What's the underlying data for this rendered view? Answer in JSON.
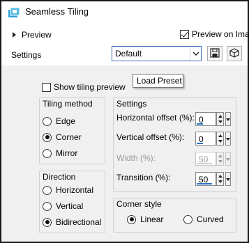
{
  "window": {
    "title": "Seamless Tiling"
  },
  "header": {
    "preview_label": "Preview",
    "preview_on_image_label": "Preview on Imag",
    "preview_on_image_checked": true,
    "settings_label": "Settings",
    "preset_value": "Default",
    "tooltip": "Load Preset"
  },
  "options": {
    "show_tiling_preview_label": "Show tiling preview",
    "show_tiling_preview_checked": false
  },
  "tiling_method": {
    "title": "Tiling method",
    "options": [
      "Edge",
      "Corner",
      "Mirror"
    ],
    "selected": "Corner"
  },
  "direction": {
    "title": "Direction",
    "options": [
      "Horizontal",
      "Vertical",
      "Bidirectional"
    ],
    "selected": "Bidirectional"
  },
  "settings_group": {
    "title": "Settings",
    "horizontal_offset": {
      "label": "Horizontal offset (%):",
      "value": "0",
      "level": 0.0
    },
    "vertical_offset": {
      "label": "Vertical offset (%):",
      "value": "0",
      "level": 0.0
    },
    "width": {
      "label": "Width (%):",
      "value": "50",
      "level": 0.5,
      "disabled": true
    },
    "transition": {
      "label": "Transition (%):",
      "value": "50",
      "level": 0.5
    }
  },
  "corner_style": {
    "title": "Corner style",
    "options": [
      "Linear",
      "Curved"
    ],
    "selected": "Linear"
  },
  "colors": {
    "accent": "#2e74c9",
    "app_icon": "#2ea3d8"
  },
  "icons": {
    "app": "seamless-tiling-app-icon",
    "preset_dropdown": "chevron-down-icon",
    "save_preset": "floppy-disk-icon",
    "load_preset": "cube-icon"
  }
}
